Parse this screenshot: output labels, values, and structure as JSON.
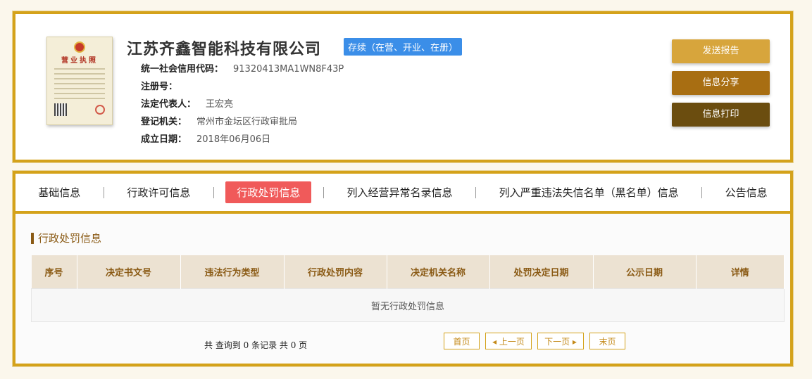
{
  "company": {
    "name": "江苏齐鑫智能科技有限公司",
    "status": "存续（在营、开业、在册）",
    "license_title": "营业执照",
    "fields": [
      {
        "label": "统一社会信用代码：",
        "value": "91320413MA1WN8F43P"
      },
      {
        "label": "注册号：",
        "value": ""
      },
      {
        "label": "法定代表人：",
        "value": "王宏亮"
      },
      {
        "label": "登记机关：",
        "value": "常州市金坛区行政审批局"
      },
      {
        "label": "成立日期：",
        "value": "2018年06月06日"
      }
    ]
  },
  "actions": {
    "send_report": "发送报告",
    "share": "信息分享",
    "print": "信息打印"
  },
  "tabs": [
    {
      "label": "基础信息",
      "active": false
    },
    {
      "label": "行政许可信息",
      "active": false
    },
    {
      "label": "行政处罚信息",
      "active": true
    },
    {
      "label": "列入经营异常名录信息",
      "active": false
    },
    {
      "label": "列入严重违法失信名单（黑名单）信息",
      "active": false
    },
    {
      "label": "公告信息",
      "active": false
    }
  ],
  "section": {
    "title": "行政处罚信息",
    "columns": [
      "序号",
      "决定书文号",
      "违法行为类型",
      "行政处罚内容",
      "决定机关名称",
      "处罚决定日期",
      "公示日期",
      "详情"
    ],
    "empty_text": "暂无行政处罚信息"
  },
  "pager": {
    "summary": "共 查询到 0 条记录 共 0 页",
    "first": "首页",
    "prev": "上一页",
    "next": "下一页",
    "last": "末页"
  },
  "colors": {
    "frame": "#d4a21a",
    "active_tab": "#f05a5a",
    "status_badge": "#3b8ee8"
  }
}
